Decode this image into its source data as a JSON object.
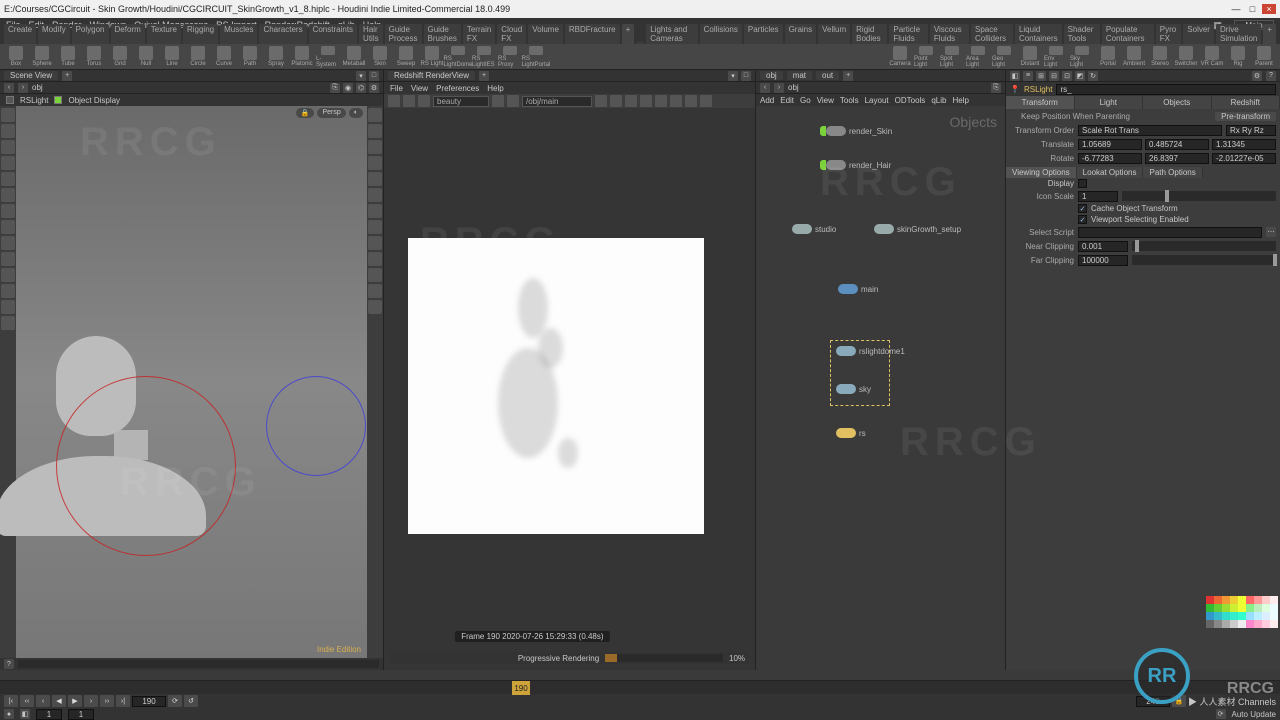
{
  "title": "E:/Courses/CGCircuit - Skin Growth/Houdini/CGCIRCUIT_SkinGrowth_v1_8.hiplc - Houdini Indie Limited-Commercial 18.0.499",
  "mainMenu": [
    "File",
    "Edit",
    "Render",
    "Windows",
    "Quixel Megascans",
    "RS Import",
    "Render:Redshift",
    "qLib",
    "Help"
  ],
  "mainMenuRightLabel": "Main",
  "shelfTabsLeft": [
    "Create",
    "Modify",
    "Polygon",
    "Deform",
    "Texture",
    "Rigging",
    "Muscles",
    "Characters",
    "Constraints",
    "Hair Utils",
    "Guide Process",
    "Guide Brushes",
    "Terrain FX",
    "Cloud FX",
    "Volume",
    "RBDFracture",
    "+"
  ],
  "shelfTabsRight": [
    "Lights and Cameras",
    "Collisions",
    "Particles",
    "Grains",
    "Vellum",
    "Rigid Bodies",
    "Particle Fluids",
    "Viscous Fluids",
    "Space Colliders",
    "Liquid Containers",
    "Shader Tools",
    "Populate Containers",
    "Pyro FX",
    "Solver",
    "Drive Simulation",
    "+"
  ],
  "shelfIconsLeft": [
    "Box",
    "Sphere",
    "Tube",
    "Torus",
    "Grid",
    "Null",
    "Line",
    "Circle",
    "Curve",
    "Path",
    "Spray",
    "Platonic",
    "L-System",
    "Metaball",
    "Skin",
    "Sweep",
    "RS Light",
    "RS LightDome",
    "RS LightIES",
    "RS Proxy",
    "RS LightPortal"
  ],
  "shelfIconsRight": [
    "Camera",
    "Point Light",
    "Spot Light",
    "Area Light",
    "Geo Light",
    "Distant",
    "Env Light",
    "Sky Light",
    "Portal",
    "Ambient",
    "Stereo",
    "Switcher",
    "VR Cam",
    "Rig",
    "Parent"
  ],
  "sceneView": {
    "tabLabel": "Scene View",
    "toolrow_item1": "RSLight",
    "toolrow_item2": "Object Display",
    "persp": "Persp",
    "indie": "Indie Edition"
  },
  "renderView": {
    "tabLabel": "Redshift RenderView",
    "menu": [
      "File",
      "View",
      "Preferences",
      "Help"
    ],
    "aov": "beauty",
    "path": "/obj/main",
    "status": "Frame  190   2020-07-26  15:29:33  (0.48s)",
    "progressLabel": "Progressive Rendering",
    "progressPct": "10%"
  },
  "network": {
    "pathTabs": [
      "obj",
      "mat",
      "out"
    ],
    "path": "obj",
    "label": "Objects",
    "menu": [
      "Add",
      "Edit",
      "Go",
      "View",
      "Tools",
      "Layout",
      "ODTools",
      "qLib",
      "Help"
    ],
    "nodes": {
      "render_skin": "render_Skin",
      "render_hair": "render_Hair",
      "studio": "studio",
      "skingrowth": "skinGrowth_setup",
      "main": "main",
      "rslightdome1": "rslightdome1",
      "sky": "sky",
      "rslight": "rs"
    }
  },
  "parms": {
    "nodeType": "RSLight",
    "nodeName": "rs_",
    "tabs": [
      "Transform",
      "Light",
      "Objects",
      "Redshift"
    ],
    "keepPos": "Keep Position When Parenting",
    "preXform": "Pre-transform",
    "xformOrder": "Transform Order",
    "xformOrderVal1": "Scale Rot Trans",
    "xformOrderVal2": "Rx Ry Rz",
    "translate": "Translate",
    "tx": "1.05689",
    "ty": "0.485724",
    "tz": "1.31345",
    "rotate": "Rotate",
    "rx": "-6.77283",
    "ry": "26.8397",
    "rz": "-2.01227e-05",
    "subtabs": [
      "Viewing Options",
      "Lookat Options",
      "Path Options"
    ],
    "display": "Display",
    "iconScale": "Icon Scale",
    "iconScaleVal": "1",
    "cacheObj": "Cache Object Transform",
    "vpSelect": "Viewport Selecting Enabled",
    "selectScript": "Select Script",
    "nearClip": "Near Clipping",
    "nearClipVal": "0.001",
    "farClip": "Far Clipping",
    "farClipVal": "100000"
  },
  "playbar": {
    "frame": "190",
    "start": "1",
    "end": "1",
    "autoUpdate": "Auto Update",
    "channels": "▶ 人人素材 Channels"
  },
  "palette": [
    "#d33",
    "#e63",
    "#e93",
    "#ec3",
    "#ef3",
    "#f66",
    "#f99",
    "#fcc",
    "#fee",
    "#3b3",
    "#6c3",
    "#9d3",
    "#ce3",
    "#ef3",
    "#8e8",
    "#beb",
    "#dfd",
    "#eff",
    "#39c",
    "#3bc",
    "#3dc",
    "#3ec",
    "#3fc",
    "#9df",
    "#bef",
    "#def",
    "#eff",
    "#666",
    "#888",
    "#aaa",
    "#ccc",
    "#eee",
    "#f8c",
    "#fac",
    "#fcd",
    "#fee"
  ],
  "watermark": "RRCG",
  "logochars": "RR"
}
